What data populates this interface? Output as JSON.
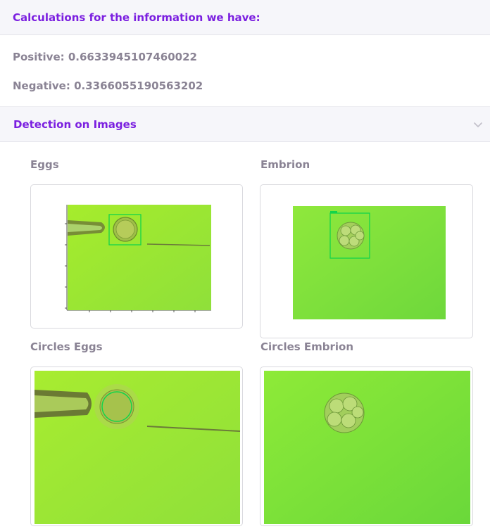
{
  "calculations": {
    "header": "Calculations for the information we have:",
    "positive": "Positive: 0.6633945107460022",
    "negative": "Negative: 0.3366055190563202"
  },
  "detection": {
    "header": "Detection on Images",
    "toggle_icon": "chevron-down-icon",
    "images": [
      {
        "label": "Eggs"
      },
      {
        "label": "Embrion"
      },
      {
        "label": "Circles Eggs"
      },
      {
        "label": "Circles Embrion"
      }
    ]
  },
  "colors": {
    "accent": "#7b1fe0",
    "header_bg": "#f6f6fa",
    "text_muted": "#8a8394",
    "detection_box": "#13d44a"
  }
}
